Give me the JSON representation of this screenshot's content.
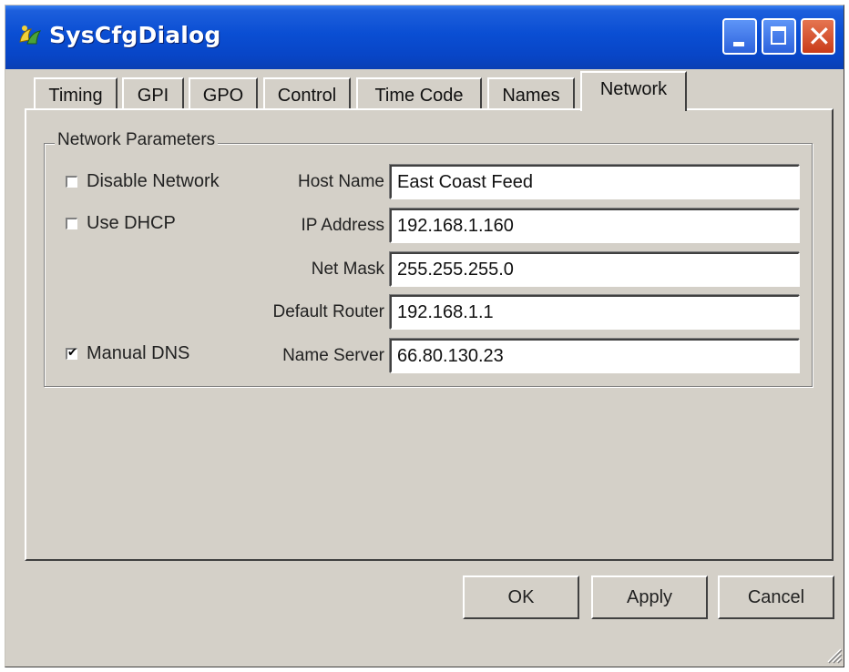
{
  "window": {
    "title": "SysCfgDialog"
  },
  "titlebar_icons": {
    "app": "app-icon",
    "minimize": "minimize-icon",
    "maximize": "maximize-icon",
    "close": "close-icon"
  },
  "tabs": [
    {
      "label": "Timing"
    },
    {
      "label": "GPI"
    },
    {
      "label": "GPO"
    },
    {
      "label": "Control"
    },
    {
      "label": "Time Code"
    },
    {
      "label": "Names"
    },
    {
      "label": "Network"
    }
  ],
  "active_tab": "Network",
  "group": {
    "label": "Network Parameters"
  },
  "checkboxes": {
    "disable_network": {
      "label": "Disable Network",
      "checked": false
    },
    "use_dhcp": {
      "label": "Use DHCP",
      "checked": false
    },
    "manual_dns": {
      "label": "Manual DNS",
      "checked": true
    }
  },
  "fields": {
    "host_name": {
      "label": "Host Name",
      "value": "East Coast Feed"
    },
    "ip_address": {
      "label": "IP Address",
      "value": "192.168.1.160"
    },
    "net_mask": {
      "label": "Net Mask",
      "value": "255.255.255.0"
    },
    "default_router": {
      "label": "Default Router",
      "value": "192.168.1.1"
    },
    "name_server": {
      "label": "Name Server",
      "value": "66.80.130.23"
    }
  },
  "buttons": {
    "ok": "OK",
    "apply": "Apply",
    "cancel": "Cancel"
  },
  "colors": {
    "titlebar": "#0a4ed3",
    "dialog": "#d4d0c8",
    "close_button": "#c93c1a"
  }
}
